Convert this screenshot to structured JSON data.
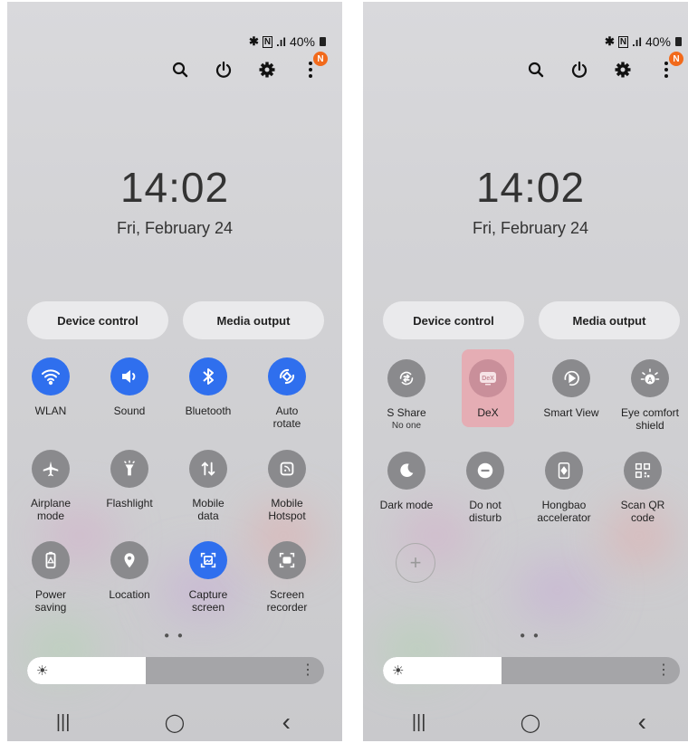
{
  "left": {
    "status": {
      "bt": "✱",
      "nfc": "N",
      "signal": ".ıl",
      "battery": "40%"
    },
    "notif_badge": "N",
    "clock": "14:02",
    "date": "Fri, February 24",
    "device_control": "Device control",
    "media_output": "Media output",
    "tiles": [
      {
        "label": "WLAN",
        "icon": "wifi-icon",
        "on": true
      },
      {
        "label": "Sound",
        "icon": "sound-icon",
        "on": true
      },
      {
        "label": "Bluetooth",
        "icon": "bluetooth-icon",
        "on": true
      },
      {
        "label": "Auto\nrotate",
        "icon": "rotate-icon",
        "on": true
      },
      {
        "label": "Airplane\nmode",
        "icon": "airplane-icon",
        "on": false
      },
      {
        "label": "Flashlight",
        "icon": "flashlight-icon",
        "on": false
      },
      {
        "label": "Mobile\ndata",
        "icon": "mobile-data-icon",
        "on": false
      },
      {
        "label": "Mobile\nHotspot",
        "icon": "hotspot-icon",
        "on": false
      },
      {
        "label": "Power\nsaving",
        "icon": "battery-icon",
        "on": false
      },
      {
        "label": "Location",
        "icon": "location-icon",
        "on": false
      },
      {
        "label": "Capture\nscreen",
        "icon": "capture-icon",
        "on": true
      },
      {
        "label": "Screen\nrecorder",
        "icon": "recorder-icon",
        "on": false
      }
    ],
    "page_dots": "● ●",
    "brightness": 0.4
  },
  "right": {
    "status": {
      "bt": "✱",
      "nfc": "N",
      "signal": ".ıl",
      "battery": "40%"
    },
    "notif_badge": "N",
    "clock": "14:02",
    "date": "Fri, February 24",
    "device_control": "Device control",
    "media_output": "Media output",
    "tiles": [
      {
        "label": "S Share",
        "sub": "No one",
        "icon": "s-share-icon",
        "on": false
      },
      {
        "label": "DeX",
        "icon": "dex-icon",
        "on": false,
        "highlight": true
      },
      {
        "label": "Smart View",
        "icon": "smart-view-icon",
        "on": false
      },
      {
        "label": "Eye comfort\nshield",
        "icon": "eye-comfort-icon",
        "on": false
      },
      {
        "label": "Dark mode",
        "icon": "dark-mode-icon",
        "on": false
      },
      {
        "label": "Do not\ndisturb",
        "icon": "dnd-icon",
        "on": false
      },
      {
        "label": "Hongbao\naccelerator",
        "icon": "hongbao-icon",
        "on": false
      },
      {
        "label": "Scan QR\ncode",
        "icon": "qr-icon",
        "on": false
      }
    ],
    "add_label": "+",
    "page_dots": "● ●",
    "brightness": 0.4
  },
  "nav": {
    "recents": "|||",
    "home": "◯",
    "back": "‹"
  },
  "colors": {
    "accent": "#2f6fee",
    "off": "#8a8a8d",
    "badge": "#f26a1b",
    "dex_highlight": "#e7a8b0"
  }
}
